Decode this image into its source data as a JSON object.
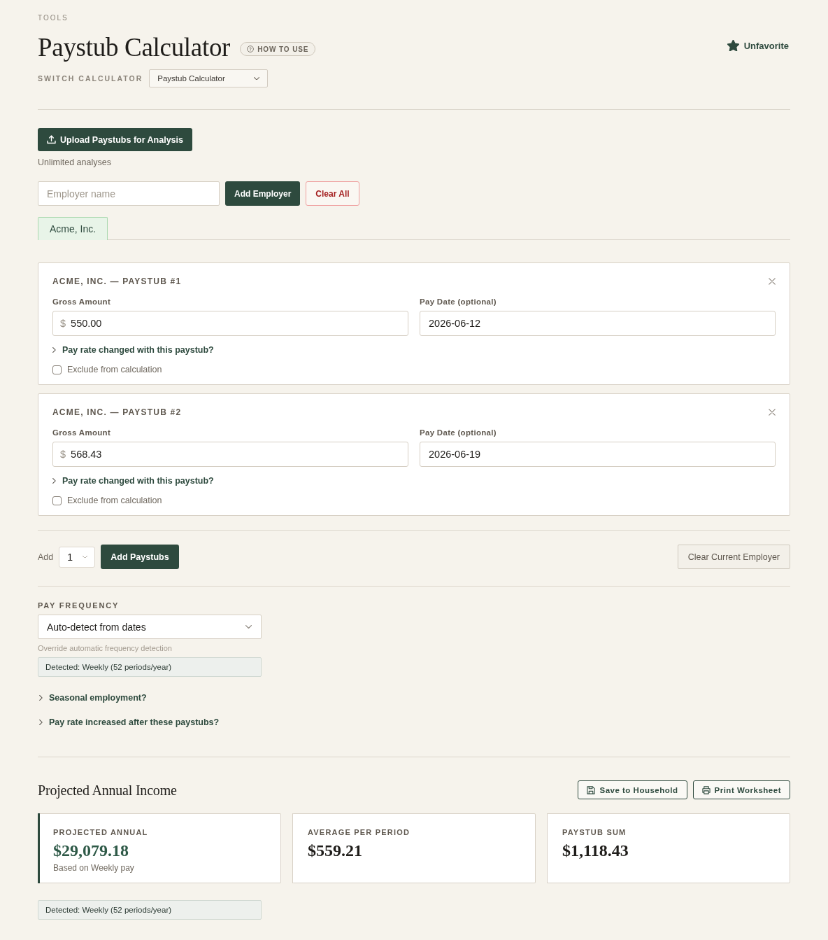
{
  "header": {
    "eyebrow": "TOOLS",
    "title": "Paystub Calculator",
    "help_button": "HOW TO USE",
    "favorite": {
      "label": "Unfavorite",
      "favorited": true
    },
    "switch_calculator": {
      "label": "SWITCH CALCULATOR",
      "value": "Paystub Calculator"
    }
  },
  "upload": {
    "button": "Upload Paystubs for Analysis",
    "note": "Unlimited analyses"
  },
  "employer_form": {
    "placeholder": "Employer name",
    "add_button": "Add Employer",
    "clear_button": "Clear All"
  },
  "employer_tabs": [
    {
      "label": "Acme, Inc.",
      "selected": true
    }
  ],
  "paystubs": [
    {
      "title": "ACME, INC. — PAYSTUB #1",
      "gross_label": "Gross Amount",
      "currency": "$",
      "gross": "550.00",
      "date_label": "Pay Date (optional)",
      "date": "2026-06-12",
      "rate_toggle": {
        "label": "Pay rate changed with this paystub?",
        "expanded": false
      },
      "exclude": {
        "label": "Exclude from calculation",
        "checked": false
      }
    },
    {
      "title": "ACME, INC. — PAYSTUB #2",
      "gross_label": "Gross Amount",
      "currency": "$",
      "gross": "568.43",
      "date_label": "Pay Date (optional)",
      "date": "2026-06-19",
      "rate_toggle": {
        "label": "Pay rate changed with this paystub?",
        "expanded": false
      },
      "exclude": {
        "label": "Exclude from calculation",
        "checked": false
      }
    }
  ],
  "add_row": {
    "label": "Add",
    "count": "1",
    "add_button": "Add Paystubs",
    "clear_button": "Clear Current Employer"
  },
  "pay_frequency": {
    "label": "PAY FREQUENCY",
    "value": "Auto-detect from dates",
    "hint": "Override automatic frequency detection",
    "detected": "Detected: Weekly (52 periods/year)"
  },
  "toggles": [
    {
      "label": "Seasonal employment?",
      "expanded": false
    },
    {
      "label": "Pay rate increased after these paystubs?",
      "expanded": false
    }
  ],
  "results": {
    "title": "Projected Annual Income",
    "buttons": [
      {
        "label": "Save to Household",
        "kind": "save"
      },
      {
        "label": "Print Worksheet",
        "kind": "print"
      }
    ],
    "cards": [
      {
        "label": "PROJECTED ANNUAL",
        "value": "$29,079.18",
        "note": "Based on Weekly pay",
        "highlighted": true
      },
      {
        "label": "AVERAGE PER PERIOD",
        "value": "$559.21",
        "highlighted": false
      },
      {
        "label": "PAYSTUB SUM",
        "value": "$1,118.43",
        "highlighted": false
      }
    ],
    "detected": "Detected: Weekly (52 periods/year)"
  }
}
